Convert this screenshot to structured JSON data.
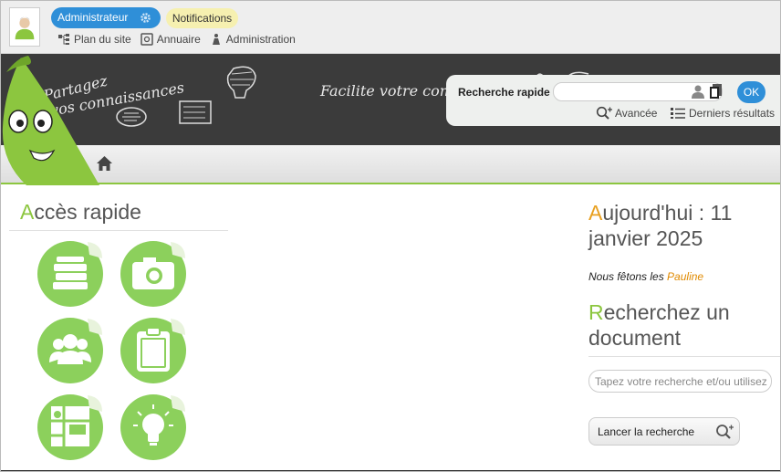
{
  "colors": {
    "accent_green": "#8cc63f",
    "accent_blue": "#2f8fd8",
    "accent_orange": "#e8a020",
    "banner_bg": "#3b3b3b"
  },
  "topbar": {
    "admin_label": "Administrateur",
    "notifications_label": "Notifications",
    "links": [
      {
        "label": "Plan du site",
        "icon": "sitemap-icon"
      },
      {
        "label": "Annuaire",
        "icon": "directory-icon"
      },
      {
        "label": "Administration",
        "icon": "admin-icon"
      }
    ]
  },
  "banner": {
    "chalk_line_1": "Partagez",
    "chalk_line_2": "vos connaissances",
    "chalk_line_3": "Facilite votre comm"
  },
  "quick_search": {
    "label": "Recherche rapide",
    "value": "",
    "ok_label": "OK",
    "advanced_label": "Avancée",
    "last_results_label": "Derniers résultats"
  },
  "quick_access": {
    "title_first": "A",
    "title_rest": "ccès rapide",
    "tiles": [
      {
        "icon": "books-icon"
      },
      {
        "icon": "camera-icon"
      },
      {
        "icon": "people-icon"
      },
      {
        "icon": "clipboard-icon"
      },
      {
        "icon": "calendar-map-icon"
      },
      {
        "icon": "lightbulb-icon"
      }
    ]
  },
  "today": {
    "title_first": "A",
    "title_rest": "ujourd'hui : 11 janvier 2025",
    "feast_prefix": "Nous fêtons les ",
    "feast_name": "Pauline"
  },
  "doc_search": {
    "title_first": "R",
    "title_rest": "echerchez un document",
    "placeholder": "Tapez votre recherche et/ou utilisez",
    "button_label": "Lancer la recherche"
  }
}
